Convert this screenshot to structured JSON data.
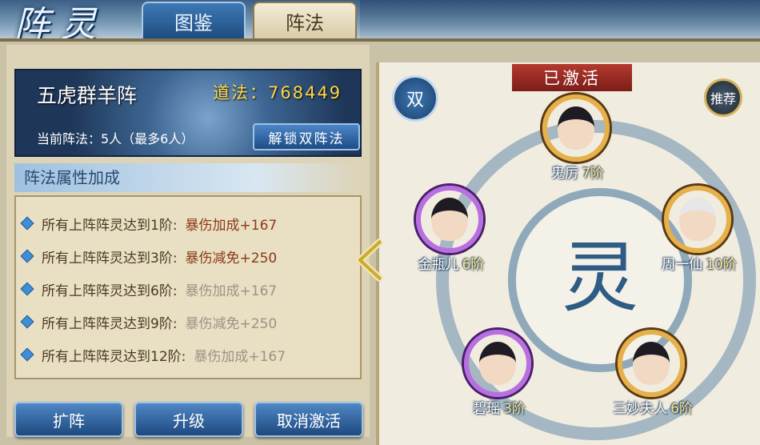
{
  "window_title": "阵灵",
  "tabs": [
    {
      "label": "图鉴"
    },
    {
      "label": "阵法"
    }
  ],
  "formation": {
    "name": "五虎群羊阵",
    "dao_label": "道法：768449",
    "current_label": "当前阵法：5人（最多6人）",
    "unlock_button": "解锁双阵法"
  },
  "section_title": "阵法属性加成",
  "bonuses": [
    {
      "condition": "所有上阵阵灵达到1阶:",
      "bonus": "暴伤加成+167",
      "active": true
    },
    {
      "condition": "所有上阵阵灵达到3阶:",
      "bonus": "暴伤减免+250",
      "active": true
    },
    {
      "condition": "所有上阵阵灵达到6阶:",
      "bonus": "暴伤加成+167",
      "active": false
    },
    {
      "condition": "所有上阵阵灵达到9阶:",
      "bonus": "暴伤减免+250",
      "active": false
    },
    {
      "condition": "所有上阵阵灵达到12阶:",
      "bonus": "暴伤加成+167",
      "active": false
    }
  ],
  "buttons": {
    "expand": "扩阵",
    "upgrade": "升级",
    "deactivate": "取消激活",
    "info": "!"
  },
  "right_panel": {
    "activated": "已激活",
    "double_badge": "双",
    "recommend_badge": "推荐",
    "center_glyph": "灵"
  },
  "heroes": [
    {
      "name": "鬼厉",
      "rank": "7阶",
      "frame": "gold"
    },
    {
      "name": "金瓶儿",
      "rank": "6阶",
      "frame": "purple"
    },
    {
      "name": "周一仙",
      "rank": "10阶",
      "frame": "gold"
    },
    {
      "name": "碧瑶",
      "rank": "3阶",
      "frame": "purple"
    },
    {
      "name": "三妙夫人",
      "rank": "6阶",
      "frame": "gold"
    }
  ],
  "colors": {
    "accent_blue": "#2a5b8f",
    "dao_gold": "#ffd84a",
    "bonus_active": "#8a3a16",
    "bonus_inactive": "#9a9486",
    "activated_red": "#b3392e"
  }
}
